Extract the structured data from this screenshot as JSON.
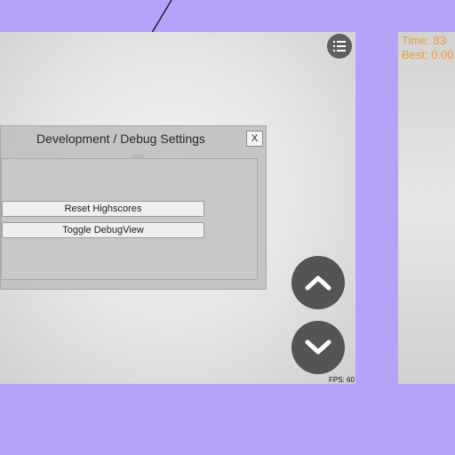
{
  "hud": {
    "time_label": "Time: 83",
    "best_label": "Best: 0.00"
  },
  "dialog": {
    "title": "Development / Debug Settings",
    "close_label": "X",
    "buttons": [
      "Reset Highscores",
      "Toggle DebugView"
    ]
  },
  "controls": {
    "up_icon": "chevron-up-icon",
    "down_icon": "chevron-down-icon",
    "menu_icon": "menu-list-icon"
  },
  "fps_label": "FPS: 60",
  "colors": {
    "background": "#b6a1fb",
    "hud_text": "#e8a040",
    "circle_button": "#545454"
  }
}
